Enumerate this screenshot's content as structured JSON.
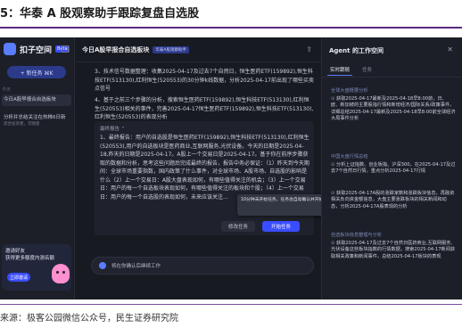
{
  "figure": {
    "title": "5：华泰 A 股观察助手跟踪复盘自选股",
    "source": "来源：极客公园微信公众号，民生证券研究院"
  },
  "sidebar": {
    "brand": "扣子空间",
    "brand_badge": "Beta",
    "new_task": "+ 新任务 ⌘K",
    "section": "今天",
    "items": [
      {
        "label": "今日A股早报合自选板块",
        "sub": ""
      },
      {
        "label": "分析并总结关注在热株6日新",
        "sub": "适合投资者，可随意"
      }
    ],
    "invite_line1": "邀请好友",
    "invite_line2": "获得更多额度内测名额",
    "invite_button": "立即邀请"
  },
  "chat": {
    "title": "今日A股早报合自选板块",
    "badge": "华泰A股观察助手",
    "messages": [
      "3、技术信号数据整理：收集2025-04-17及过去7个自然日，恒生医药ETF(159892),恒生科技ETF(513130),红利恒生(520553)的30分钟k线数据，分析2025-04-17前出现了哪些买卖点信号",
      "4、基于之前三个步骤的分析，搜索恒生医药ETF(159892),恒生科技ETF(513130),红利恒生(520553)相关的事件，完善2025-04-17恒生医药ETF(159892),恒生科技ETF(513130),红利恒生(520553)的表现分析"
    ],
    "box_head": "最终报告 ⌃",
    "box_body": "1、最终报告：用户的自选股是恒生医药ETF(159892),恒生科技ETF(513130),红利恒生(520553),用户的自选板块是医药商业,互联网服务,光伏设备。今天的日期是2025-04-18,昨天的日期是2025-04-17。A股上一个交易日是2025-04-17。基于你在前序步骤获取的数据和分析，思考这些问题后完成最终的报告，报告中务必保证：（1）昨天到今天期间：全球市场重要指数，国内政策了什么事件，对全球市场、A股市场、自选股的影响是什么（2）上一个交易日：A股大盘表现如何，有哪些值得关注的机会；（3）上一个交易日：用户的每一个自选板块表现如何，有哪些值得关注的板块和个股；（4）上一个交易日：用户的每一个自选股的表现如何，未来应该关注...",
    "tooltip": "10分钟未开始任务，任务会自动确认并开始",
    "edit_button": "修改任务",
    "start_button": "开始任务",
    "composer_text": "将在你确认后继续工作"
  },
  "panel": {
    "title": "Agent 的工作空间",
    "tabs": [
      "实时跟随",
      "任务"
    ],
    "sections": [
      {
        "title": "全球大盘概要分析",
        "text": "获取2025-04-17最新及2025-04-18早8:00前，日、欧、新加坡的主要股指行情和新增经济/国际关系/政策事件，详细总结2025-04-17最新及2025-04-18早8:00前全球经济大局事件分析"
      },
      {
        "title": "中国大盘行情总结",
        "text": "分析上证指数、创业板指、沪深300，在2025-04-17及过去7个自然日行情，重点分析2025-04-17行情"
      },
      {
        "title": "",
        "text": "获取2025-04-17A股的涨跌家数和涨跌板块信息，再融资相关负向资金额信息，大盘主要涨跌板块的相关新闻和动态，分析2025-04-17A股表现的分析"
      },
      {
        "title": "自选板块信息整理与分析",
        "text": "获取2025-04-17及过去7个自然日医药商业,互联网服务,光伏设备这些板块指数的行情数据，搜索2025-04-17新闻获取相关政策和新闻事件，总结2025-04-17板块的表现"
      }
    ]
  }
}
